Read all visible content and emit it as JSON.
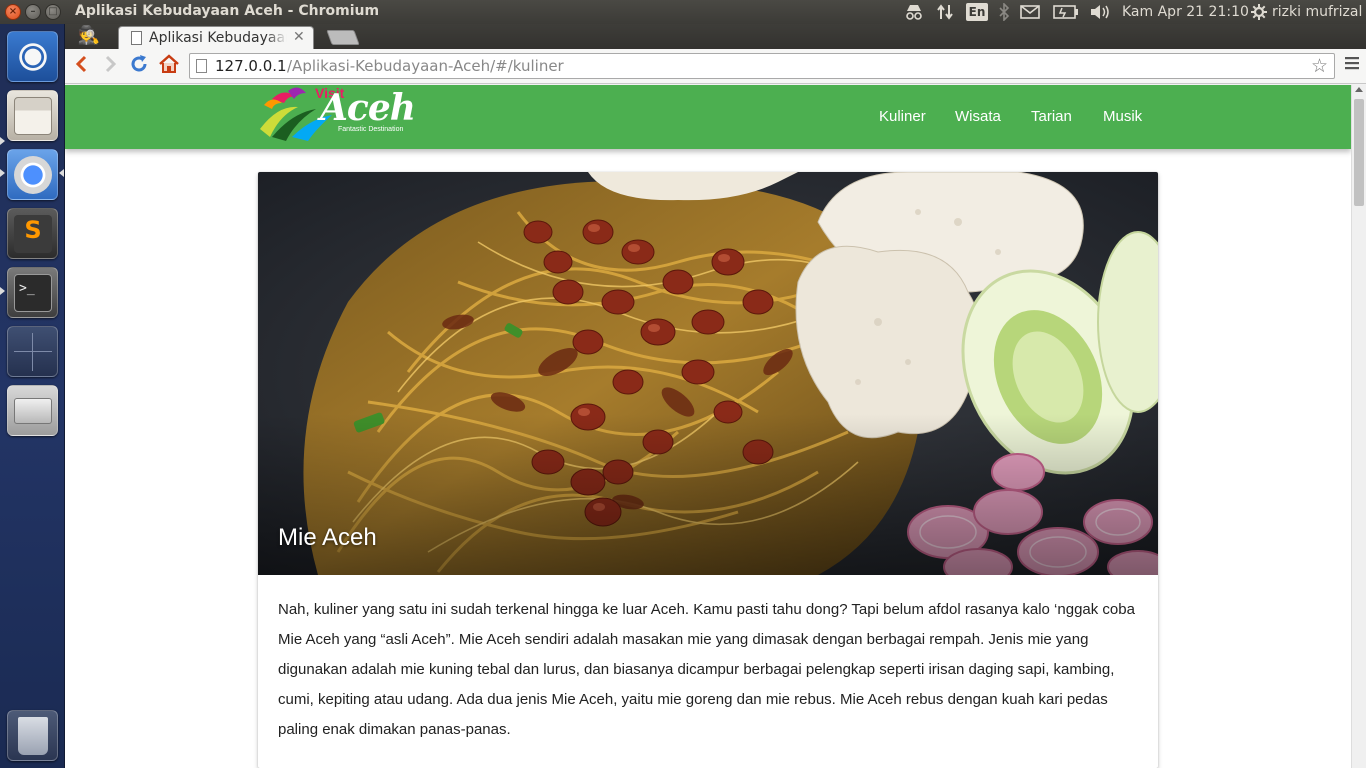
{
  "system_panel": {
    "window_title": "Aplikasi Kebudayaan Aceh - Chromium",
    "keyboard_layout": "En",
    "clock": "Kam Apr 21 21:10",
    "user": "rizki mufrizal",
    "icons": [
      "incognito-icon",
      "network-icon",
      "bluetooth-icon",
      "mail-icon",
      "battery-icon",
      "volume-icon",
      "gear-icon"
    ]
  },
  "launcher": {
    "items": [
      "ubuntu-dash",
      "files",
      "chromium",
      "sublime-text",
      "terminal",
      "workspace-switcher",
      "drive",
      "trash"
    ]
  },
  "browser": {
    "tab_title": "Aplikasi Kebudayaan Aceh",
    "url_host": "127.0.0.1",
    "url_path": "/Aplikasi-Kebudayaan-Aceh/#/kuliner"
  },
  "site": {
    "logo": {
      "visit": "Visit",
      "aceh": "Aceh",
      "tagline": "Fantastic Destination"
    },
    "nav": [
      "Kuliner",
      "Wisata",
      "Tarian",
      "Musik"
    ]
  },
  "card": {
    "title": "Mie Aceh",
    "text": "Nah, kuliner yang satu ini sudah terkenal hingga ke luar Aceh. Kamu pasti tahu dong? Tapi belum afdol rasanya kalo ‘nggak coba Mie Aceh yang “asli Aceh”. Mie Aceh sendiri adalah masakan mie yang dimasak dengan berbagai rempah. Jenis mie yang digunakan adalah mie kuning tebal dan lurus, dan biasanya dicampur berbagai pelengkap seperti irisan daging sapi, kambing, cumi, kepiting atau udang. Ada dua jenis Mie Aceh, yaitu mie goreng dan mie rebus. Mie Aceh rebus dengan kuah kari pedas paling enak dimakan panas-panas."
  },
  "colors": {
    "nav_green": "#4caf50",
    "panel_dark": "#3c3b37",
    "launcher_blue": "#233566",
    "logo_pink": "#e91e63"
  }
}
